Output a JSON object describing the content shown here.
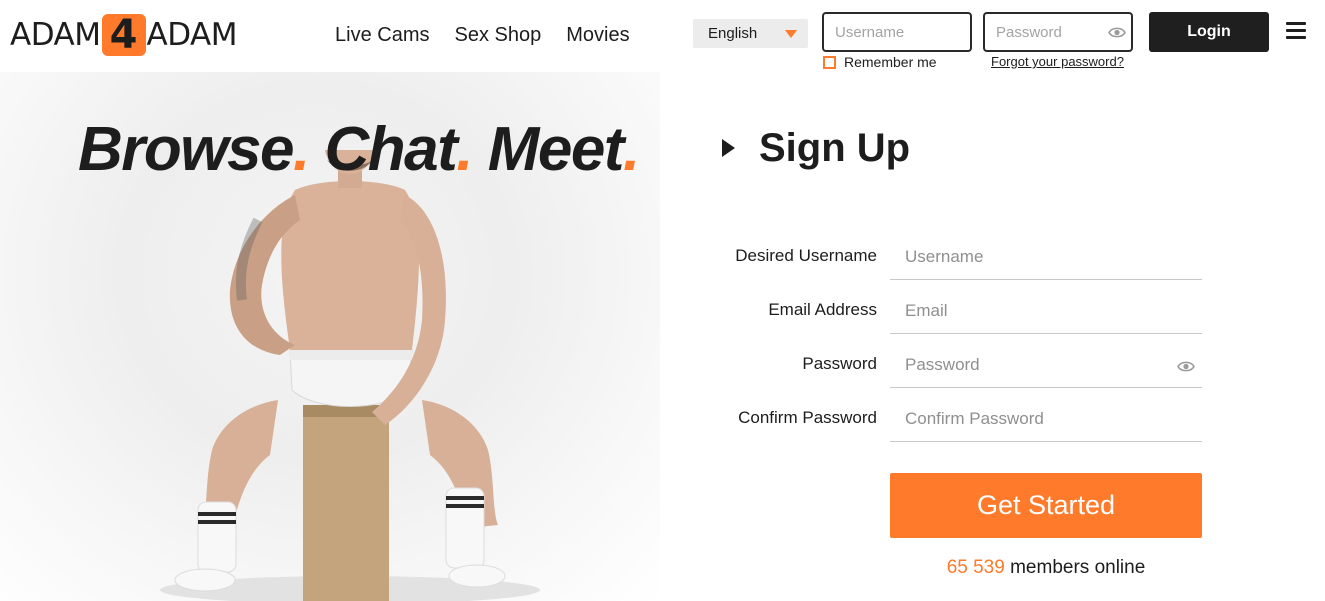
{
  "brand": {
    "left_word": "ADAM",
    "number": "4",
    "right_word": "ADAM"
  },
  "nav": [
    {
      "label": "Live Cams"
    },
    {
      "label": "Sex Shop"
    },
    {
      "label": "Movies"
    }
  ],
  "language": {
    "selected": "English"
  },
  "login": {
    "username_placeholder": "Username",
    "password_placeholder": "Password",
    "button_label": "Login",
    "remember_label": "Remember me",
    "forgot_label": "Forgot your password?"
  },
  "hero": {
    "words": [
      "Browse",
      "Chat",
      "Meet"
    ],
    "dot": "."
  },
  "signup": {
    "title": "Sign Up",
    "fields": [
      {
        "label": "Desired Username",
        "placeholder": "Username"
      },
      {
        "label": "Email Address",
        "placeholder": "Email"
      },
      {
        "label": "Password",
        "placeholder": "Password"
      },
      {
        "label": "Confirm Password",
        "placeholder": "Confirm Password"
      }
    ],
    "cta_label": "Get Started",
    "online_count": "65 539",
    "online_suffix": " members online"
  },
  "colors": {
    "accent": "#ff7a2a",
    "dark": "#1f1f1f",
    "input_border": "#2a2a2a"
  },
  "icons": [
    "menu-icon",
    "eye-icon",
    "play-icon",
    "caret-down-icon"
  ]
}
